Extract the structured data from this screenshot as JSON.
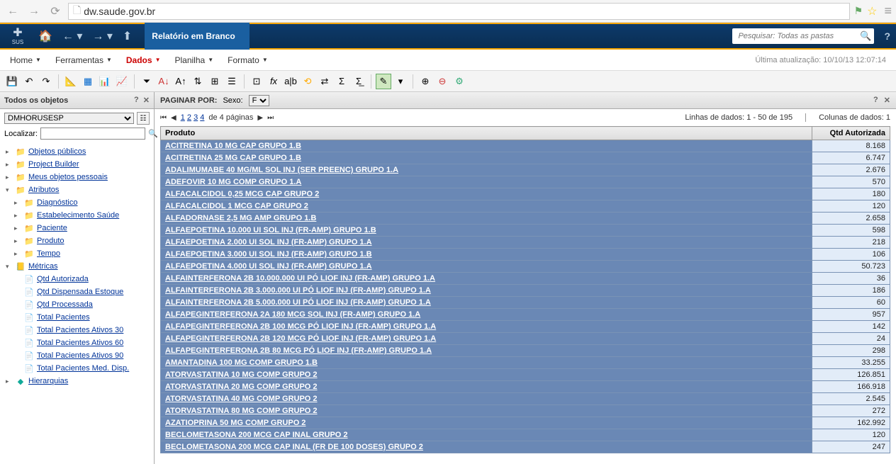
{
  "browser": {
    "url": "dw.saude.gov.br"
  },
  "header": {
    "logo_text": "SUS",
    "breadcrumb": "Relatório em Branco",
    "search_placeholder": "Pesquisar: Todas as pastas"
  },
  "menu": {
    "items": [
      {
        "label": "Home"
      },
      {
        "label": "Ferramentas"
      },
      {
        "label": "Dados",
        "active": true
      },
      {
        "label": "Planilha"
      },
      {
        "label": "Formato"
      }
    ],
    "last_update": "Última atualização: 10/10/13 12:07:14"
  },
  "left_panel": {
    "title": "Todos os objetos",
    "select_value": "DMHORUSESP",
    "search_label": "Localizar:",
    "tree": [
      {
        "label": "Objetos públicos",
        "lvl": 0,
        "icon": "folder",
        "exp": "▸"
      },
      {
        "label": "Project Builder",
        "lvl": 0,
        "icon": "folder",
        "exp": "▸"
      },
      {
        "label": "Meus objetos pessoais",
        "lvl": 0,
        "icon": "folder",
        "exp": "▸"
      },
      {
        "label": "Atributos",
        "lvl": 0,
        "icon": "folder",
        "exp": "▾"
      },
      {
        "label": "Diagnóstico",
        "lvl": 1,
        "icon": "folder",
        "exp": "▸"
      },
      {
        "label": "Estabelecimento Saúde",
        "lvl": 1,
        "icon": "folder",
        "exp": "▸"
      },
      {
        "label": "Paciente",
        "lvl": 1,
        "icon": "folder",
        "exp": "▸"
      },
      {
        "label": "Produto",
        "lvl": 1,
        "icon": "folder",
        "exp": "▸"
      },
      {
        "label": "Tempo",
        "lvl": 1,
        "icon": "folder",
        "exp": "▸"
      },
      {
        "label": "Métricas",
        "lvl": 0,
        "icon": "metric-folder",
        "exp": "▾"
      },
      {
        "label": "Qtd Autorizada",
        "lvl": 1,
        "icon": "metric",
        "exp": ""
      },
      {
        "label": "Qtd Dispensada Estoque",
        "lvl": 1,
        "icon": "metric",
        "exp": ""
      },
      {
        "label": "Qtd Processada",
        "lvl": 1,
        "icon": "metric",
        "exp": ""
      },
      {
        "label": "Total Pacientes",
        "lvl": 1,
        "icon": "metric",
        "exp": ""
      },
      {
        "label": "Total Pacientes Ativos 30",
        "lvl": 1,
        "icon": "metric",
        "exp": ""
      },
      {
        "label": "Total Pacientes Ativos 60",
        "lvl": 1,
        "icon": "metric",
        "exp": ""
      },
      {
        "label": "Total Pacientes Ativos 90",
        "lvl": 1,
        "icon": "metric",
        "exp": ""
      },
      {
        "label": "Total Pacientes Med. Disp.",
        "lvl": 1,
        "icon": "metric",
        "exp": ""
      },
      {
        "label": "Hierarquias",
        "lvl": 0,
        "icon": "hier",
        "exp": "▸"
      }
    ]
  },
  "paginate": {
    "label": "PAGINAR POR:",
    "field_label": "Sexo:",
    "field_value": "F"
  },
  "page_nav": {
    "pages": [
      "1",
      "2",
      "3",
      "4"
    ],
    "of_label": "de 4 páginas",
    "rows_info": "Linhas de dados: 1 - 50 de 195",
    "cols_info": "Colunas de dados: 1"
  },
  "grid": {
    "headers": {
      "product": "Produto",
      "qty": "Qtd Autorizada"
    },
    "rows": [
      {
        "p": "ACITRETINA 10 MG CAP   GRUPO 1.B",
        "q": "8.168"
      },
      {
        "p": "ACITRETINA 25 MG CAP   GRUPO 1.B",
        "q": "6.747"
      },
      {
        "p": "ADALIMUMABE 40 MG/ML SOL INJ (SER PREENC)   GRUPO 1.A",
        "q": "2.676"
      },
      {
        "p": "ADEFOVIR 10 MG COMP   GRUPO 1.A",
        "q": "570"
      },
      {
        "p": "ALFACALCIDOL 0,25 MCG CAP   GRUPO 2",
        "q": "180"
      },
      {
        "p": "ALFACALCIDOL 1 MCG CAP   GRUPO 2",
        "q": "120"
      },
      {
        "p": "ALFADORNASE 2,5 MG AMP   GRUPO 1.B",
        "q": "2.658"
      },
      {
        "p": "ALFAEPOETINA 10.000 UI SOL INJ (FR-AMP)   GRUPO 1.B",
        "q": "598"
      },
      {
        "p": "ALFAEPOETINA 2.000 UI SOL INJ (FR-AMP)   GRUPO 1.A",
        "q": "218"
      },
      {
        "p": "ALFAEPOETINA 3.000 UI SOL INJ (FR-AMP)   GRUPO 1.B",
        "q": "106"
      },
      {
        "p": "ALFAEPOETINA 4.000 UI SOL INJ (FR-AMP)   GRUPO 1.A",
        "q": "50.723"
      },
      {
        "p": "ALFAINTERFERONA 2B 10.000.000 UI PÓ LIOF INJ (FR-AMP)   GRUPO 1.A",
        "q": "36"
      },
      {
        "p": "ALFAINTERFERONA 2B 3.000.000 UI PÓ LIOF INJ (FR-AMP)   GRUPO 1.A",
        "q": "186"
      },
      {
        "p": "ALFAINTERFERONA 2B 5.000.000 UI PÓ LIOF INJ (FR-AMP)   GRUPO 1.A",
        "q": "60"
      },
      {
        "p": "ALFAPEGINTERFERONA 2A 180 MCG SOL INJ (FR-AMP)   GRUPO 1.A",
        "q": "957"
      },
      {
        "p": "ALFAPEGINTERFERONA 2B 100 MCG PÓ LIOF INJ (FR-AMP)   GRUPO 1.A",
        "q": "142"
      },
      {
        "p": "ALFAPEGINTERFERONA 2B 120 MCG PÓ LIOF INJ (FR-AMP)   GRUPO 1.A",
        "q": "24"
      },
      {
        "p": "ALFAPEGINTERFERONA 2B 80 MCG PÓ LIOF INJ (FR-AMP)   GRUPO 1.A",
        "q": "298"
      },
      {
        "p": "AMANTADINA 100 MG COMP   GRUPO 1.B",
        "q": "33.255"
      },
      {
        "p": "ATORVASTATINA 10 MG COMP   GRUPO 2",
        "q": "126.851"
      },
      {
        "p": "ATORVASTATINA 20 MG COMP   GRUPO 2",
        "q": "166.918"
      },
      {
        "p": "ATORVASTATINA 40 MG COMP   GRUPO 2",
        "q": "2.545"
      },
      {
        "p": "ATORVASTATINA 80 MG COMP   GRUPO 2",
        "q": "272"
      },
      {
        "p": "AZATIOPRINA 50 MG COMP   GRUPO 2",
        "q": "162.992"
      },
      {
        "p": "BECLOMETASONA 200 MCG CAP INAL   GRUPO 2",
        "q": "120"
      },
      {
        "p": "BECLOMETASONA 200 MCG CAP INAL (FR DE 100 DOSES)   GRUPO 2",
        "q": "247"
      }
    ]
  }
}
